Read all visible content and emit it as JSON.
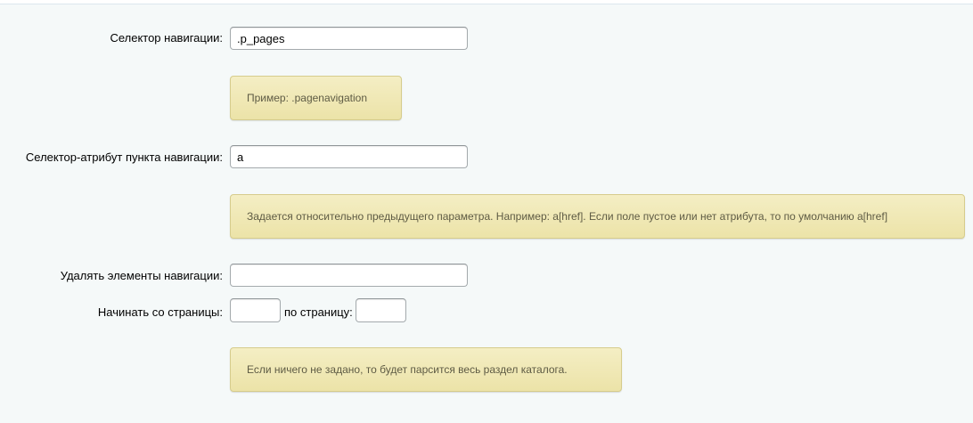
{
  "form": {
    "nav_selector": {
      "label": "Селектор навигации:",
      "value": ".p_pages",
      "hint": "Пример: .pagenavigation"
    },
    "nav_item_attr": {
      "label": "Селектор-атрибут пункта навигации:",
      "value": "a",
      "hint": "Задается относительно предыдущего параметра. Например: a[href]. Если поле пустое или нет атрибута, то по умолчанию a[href]"
    },
    "remove_nav_elements": {
      "label": "Удалять элементы навигации:",
      "value": ""
    },
    "page_range": {
      "start_label": "Начинать со страницы:",
      "start_value": "",
      "end_label": "по страницу:",
      "end_value": "",
      "hint": "Если ничего не задано, то будет парсится весь раздел каталога."
    }
  }
}
